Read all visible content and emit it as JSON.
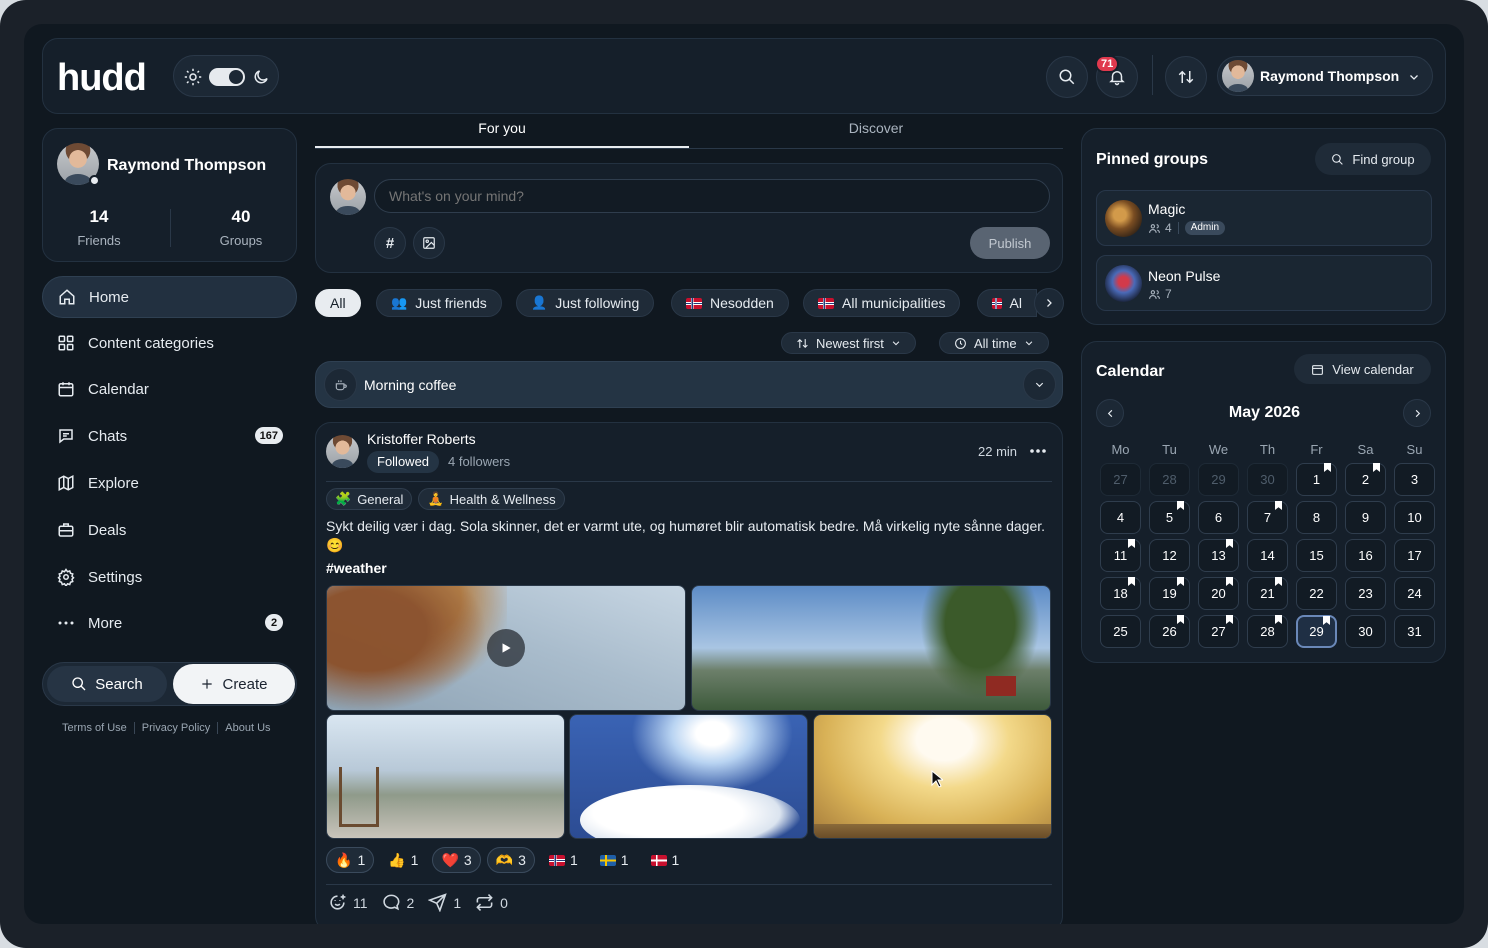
{
  "header": {
    "logo": "hudd",
    "notifications_count": "71",
    "user_name": "Raymond Thompson"
  },
  "profile": {
    "name": "Raymond Thompson",
    "friends_count": "14",
    "friends_label": "Friends",
    "groups_count": "40",
    "groups_label": "Groups"
  },
  "nav": [
    {
      "label": "Home",
      "icon": "home-icon",
      "active": true
    },
    {
      "label": "Content categories",
      "icon": "grid-icon"
    },
    {
      "label": "Calendar",
      "icon": "calendar-icon"
    },
    {
      "label": "Chats",
      "icon": "chat-icon",
      "count": "167"
    },
    {
      "label": "Explore",
      "icon": "map-icon"
    },
    {
      "label": "Deals",
      "icon": "briefcase-icon"
    },
    {
      "label": "Settings",
      "icon": "gear-icon"
    },
    {
      "label": "More",
      "icon": "dots-icon",
      "count": "2"
    }
  ],
  "bottom": {
    "search_label": "Search",
    "create_label": "Create"
  },
  "footer": {
    "terms": "Terms of Use",
    "privacy": "Privacy Policy",
    "about": "About Us"
  },
  "tabs": {
    "for_you": "For you",
    "discover": "Discover"
  },
  "composer": {
    "placeholder": "What's on your mind?",
    "publish_label": "Publish"
  },
  "filters": {
    "all": "All",
    "just_friends": "Just friends",
    "just_following": "Just following",
    "nesodden": "Nesodden",
    "all_municipalities": "All municipalities",
    "truncated": "Al"
  },
  "sort": {
    "order": "Newest first",
    "time": "All time"
  },
  "group_bar": {
    "title": "Morning coffee"
  },
  "post": {
    "author": "Kristoffer Roberts",
    "followed_label": "Followed",
    "followers": "4 followers",
    "time": "22 min",
    "tags": [
      "General",
      "Health & Wellness"
    ],
    "text": "Sykt deilig vær i dag. Sola skinner, det er varmt ute, og humøret blir automatisk bedre. Må virkelig nyte sånne dager. 😊",
    "hashtag": "#weather",
    "reactions": [
      {
        "emoji": "🔥",
        "count": "1",
        "mine": true
      },
      {
        "emoji": "👍",
        "count": "1"
      },
      {
        "emoji": "❤️",
        "count": "3",
        "mine": true
      },
      {
        "emoji": "🫶",
        "count": "3",
        "mine": true
      },
      {
        "flag": "no",
        "count": "1"
      },
      {
        "flag": "se",
        "count": "1"
      },
      {
        "flag": "dk",
        "count": "1"
      }
    ],
    "stats": {
      "reactions": "11",
      "comments": "2",
      "shares": "1",
      "reposts": "0"
    }
  },
  "pinned": {
    "title": "Pinned groups",
    "find_label": "Find group",
    "groups": [
      {
        "name": "Magic",
        "members": "4",
        "badge": "Admin"
      },
      {
        "name": "Neon Pulse",
        "members": "7"
      }
    ]
  },
  "calendar": {
    "title": "Calendar",
    "view_label": "View calendar",
    "month": "May 2026",
    "weekdays": [
      "Mo",
      "Tu",
      "We",
      "Th",
      "Fr",
      "Sa",
      "Su"
    ],
    "today": "29"
  },
  "colors": {
    "accent_badge": "#e0394e",
    "background": "#101820",
    "panel": "#151f2a"
  }
}
